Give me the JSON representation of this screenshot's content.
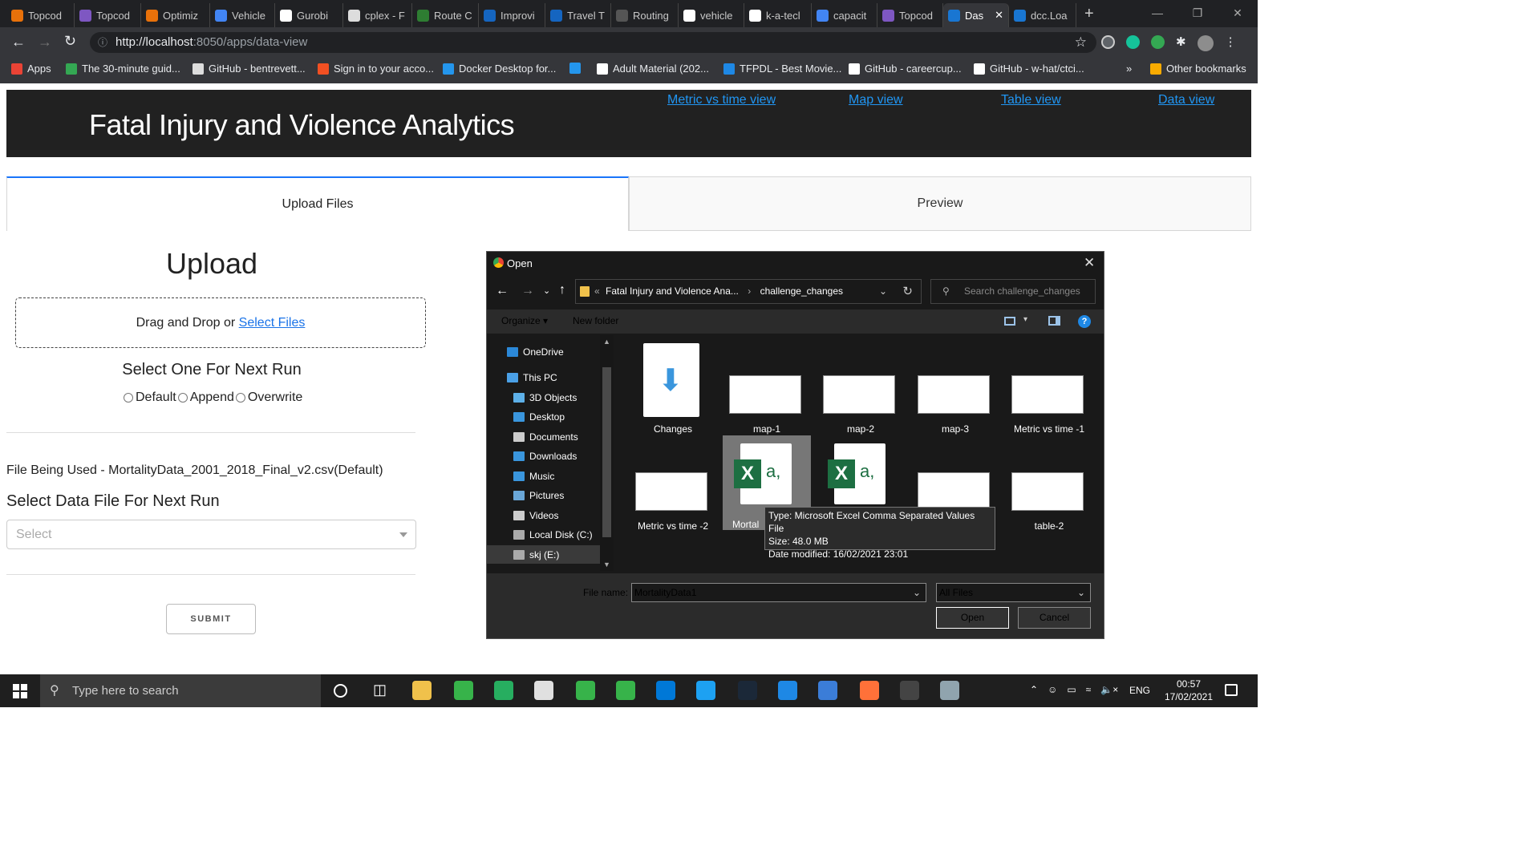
{
  "browser": {
    "tabs": [
      {
        "label": "Topcod",
        "color": "#e8710a"
      },
      {
        "label": "Topcod",
        "color": "#7e57c2"
      },
      {
        "label": "Optimiz",
        "color": "#e8710a"
      },
      {
        "label": "Vehicle",
        "color": "#4285f4"
      },
      {
        "label": "Gurobi",
        "color": "#ffffff"
      },
      {
        "label": "cplex - F",
        "color": "#dddddd"
      },
      {
        "label": "Route C",
        "color": "#2e7d32"
      },
      {
        "label": "Improvi",
        "color": "#1565c0"
      },
      {
        "label": "Travel T",
        "color": "#1565c0"
      },
      {
        "label": "Routing",
        "color": "#555555"
      },
      {
        "label": "vehicle",
        "color": "#ffffff"
      },
      {
        "label": "k-a-tecl",
        "color": "#ffffff"
      },
      {
        "label": "capacit",
        "color": "#4285f4"
      },
      {
        "label": "Topcod",
        "color": "#7e57c2"
      },
      {
        "label": "Das",
        "color": "#1976d2"
      },
      {
        "label": "dcc.Loa",
        "color": "#1976d2"
      }
    ],
    "url_host": "http://localhost",
    "url_path": ":8050/apps/data-view",
    "bookmarks": [
      {
        "label": "Apps",
        "color": "#ea4335"
      },
      {
        "label": "The 30-minute guid...",
        "color": "#34a853"
      },
      {
        "label": "GitHub - bentrevett...",
        "color": "#dddddd"
      },
      {
        "label": "Sign in to your acco...",
        "color": "#f25022"
      },
      {
        "label": "Docker Desktop for...",
        "color": "#2496ed"
      },
      {
        "label": "",
        "color": "#2496ed"
      },
      {
        "label": "Adult Material (202...",
        "color": "#ffffff"
      },
      {
        "label": "TFPDL - Best Movie...",
        "color": "#1e88e5"
      },
      {
        "label": "GitHub - careercup...",
        "color": "#ffffff"
      },
      {
        "label": "GitHub - w-hat/ctci...",
        "color": "#ffffff"
      },
      {
        "label": "»",
        "color": ""
      },
      {
        "label": "Other bookmarks",
        "color": "#f9ab00"
      }
    ]
  },
  "page": {
    "title": "Fatal Injury and Violence Analytics",
    "nav": [
      "Metric vs time view",
      "Map view",
      "Table view",
      "Data view"
    ],
    "tabs": [
      "Upload Files",
      "Preview"
    ],
    "upload_heading": "Upload",
    "drop_text": "Drag and Drop or ",
    "drop_link": "Select Files",
    "select_heading": "Select One For Next Run",
    "radios": [
      "Default",
      "Append",
      "Overwrite"
    ],
    "file_used": "File Being Used - MortalityData_2001_2018_Final_v2.csv(Default)",
    "select_data_label": "Select Data File For Next Run",
    "dropdown_placeholder": "Select",
    "submit_label": "SUBMIT"
  },
  "dialog": {
    "title": "Open",
    "path": [
      "Fatal Injury and Violence Ana...",
      "challenge_changes"
    ],
    "search_placeholder": "Search challenge_changes",
    "organize": "Organize",
    "new_folder": "New folder",
    "nav_items": [
      {
        "label": "OneDrive",
        "color": "#2b88d8"
      },
      {
        "label": "This PC",
        "color": "#4aa0e6"
      },
      {
        "label": "3D Objects",
        "color": "#5db0e8"
      },
      {
        "label": "Desktop",
        "color": "#3a96dd"
      },
      {
        "label": "Documents",
        "color": "#cccccc"
      },
      {
        "label": "Downloads",
        "color": "#3a96dd"
      },
      {
        "label": "Music",
        "color": "#3a96dd"
      },
      {
        "label": "Pictures",
        "color": "#6aa7d8"
      },
      {
        "label": "Videos",
        "color": "#cccccc"
      },
      {
        "label": "Local Disk (C:)",
        "color": "#aaaaaa"
      },
      {
        "label": "skj (E:)",
        "color": "#aaaaaa"
      }
    ],
    "files": [
      {
        "label": "Changes",
        "kind": "vscode"
      },
      {
        "label": "map-1",
        "kind": "thumb"
      },
      {
        "label": "map-2",
        "kind": "thumb"
      },
      {
        "label": "map-3",
        "kind": "thumb"
      },
      {
        "label": "Metric vs time -1",
        "kind": "thumb"
      },
      {
        "label": "Metric vs time -2",
        "kind": "thumb"
      },
      {
        "label": "Mortal",
        "kind": "excel"
      },
      {
        "label": "",
        "kind": "excel"
      },
      {
        "label": "",
        "kind": "thumb"
      },
      {
        "label": "table-2",
        "kind": "thumb"
      }
    ],
    "tooltip": [
      "Type: Microsoft Excel Comma Separated Values File",
      "Size: 48.0 MB",
      "Date modified: 16/02/2021 23:01"
    ],
    "file_name_label": "File name:",
    "file_name_value": "MortalityData1",
    "file_type": "All Files",
    "open_label": "Open",
    "cancel_label": "Cancel"
  },
  "taskbar": {
    "search_placeholder": "Type here to search",
    "lang": "ENG",
    "time": "00:57",
    "date": "17/02/2021",
    "apps": [
      "#f0c14b",
      "#37b34a",
      "#27ae60",
      "#e0e0e0",
      "#37b34a",
      "#37b34a",
      "#0078d7",
      "#1da1f2",
      "#1b2838",
      "#1e88e5",
      "#3b7dd8",
      "#ff7139",
      "#444444",
      "#90a4ae"
    ]
  }
}
